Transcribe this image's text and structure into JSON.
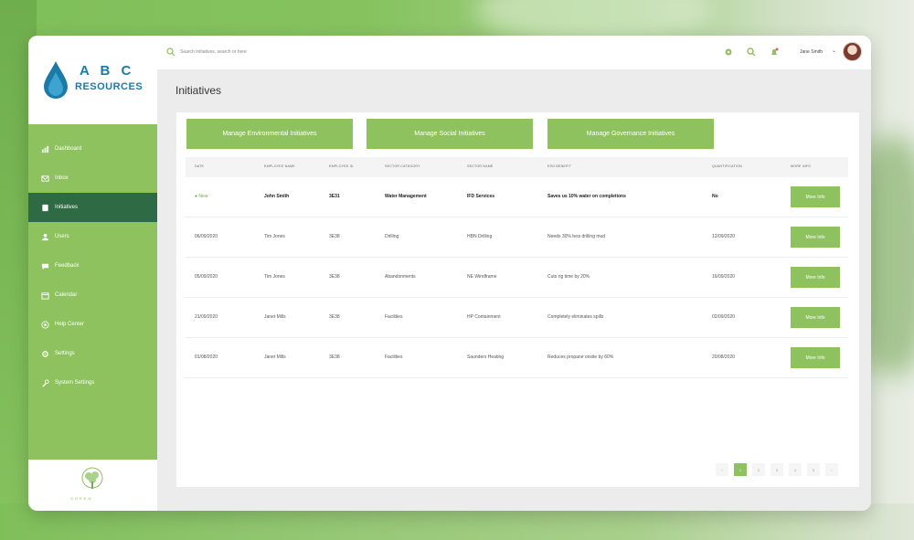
{
  "logo": {
    "line1": "A B C",
    "line2": "RESOURCES"
  },
  "sidebar": {
    "items": [
      {
        "label": "Dashboard",
        "icon": "dashboard-icon"
      },
      {
        "label": "Inbox",
        "icon": "inbox-icon"
      },
      {
        "label": "Initiatives",
        "icon": "initiatives-icon",
        "active": true
      },
      {
        "label": "Users",
        "icon": "user-icon"
      },
      {
        "label": "Feedback",
        "icon": "feedback-icon"
      },
      {
        "label": "Calendar",
        "icon": "calendar-icon"
      },
      {
        "label": "Help Center",
        "icon": "help-icon"
      },
      {
        "label": "Settings",
        "icon": "settings-icon"
      },
      {
        "label": "System Settings",
        "icon": "wrench-icon"
      }
    ],
    "footer_text": "GREEN"
  },
  "topbar": {
    "search_placeholder": "Search initiatives, search or here",
    "user_name": "Jane Smith"
  },
  "page": {
    "title": "Initiatives"
  },
  "actions": {
    "env": "Manage Environmental Initiatives",
    "social": "Manage Social Initiatives",
    "gov": "Manage Governance Initiatives"
  },
  "table": {
    "columns": [
      "Date",
      "Employee Name",
      "Employee ID",
      "Sector Category",
      "Sector Name",
      "ESG Benefit",
      "Quantification",
      "More Info"
    ],
    "rows": [
      {
        "date": "New",
        "name": "John Smith",
        "id": "3E31",
        "category": "Water Management",
        "sector": "IFD Services",
        "benefit": "Saves us 10% water on completions",
        "quant": "No",
        "button": "More Info"
      },
      {
        "date": "06/09/2020",
        "name": "Tim Jones",
        "id": "3E38",
        "category": "Drilling",
        "sector": "HBN Drilling",
        "benefit": "Needs 30% less drilling mud",
        "quant": "12/09/2020",
        "button": "More Info"
      },
      {
        "date": "05/09/2020",
        "name": "Tim Jones",
        "id": "3E38",
        "category": "Abandonments",
        "sector": "NE Windframe",
        "benefit": "Cuts rig time by 20%",
        "quant": "16/09/2020",
        "button": "More Info"
      },
      {
        "date": "21/09/2020",
        "name": "Janet Mills",
        "id": "3E38",
        "category": "Facilities",
        "sector": "HP Containment",
        "benefit": "Completely eliminates spills",
        "quant": "02/09/2020",
        "button": "More Info"
      },
      {
        "date": "01/08/2020",
        "name": "Janet Mills",
        "id": "3E38",
        "category": "Facilities",
        "sector": "Saunders Heating",
        "benefit": "Reduces propane onsite by 60%",
        "quant": "20/08/2020",
        "button": "More Info"
      }
    ]
  },
  "pagination": {
    "prev": "‹",
    "pages": [
      "1",
      "2",
      "3",
      "4",
      "5"
    ],
    "next": "›",
    "active": "1"
  },
  "colors": {
    "accent": "#8dc25e",
    "active_nav": "#2e6b45",
    "brand_blue": "#1c7ba6"
  }
}
